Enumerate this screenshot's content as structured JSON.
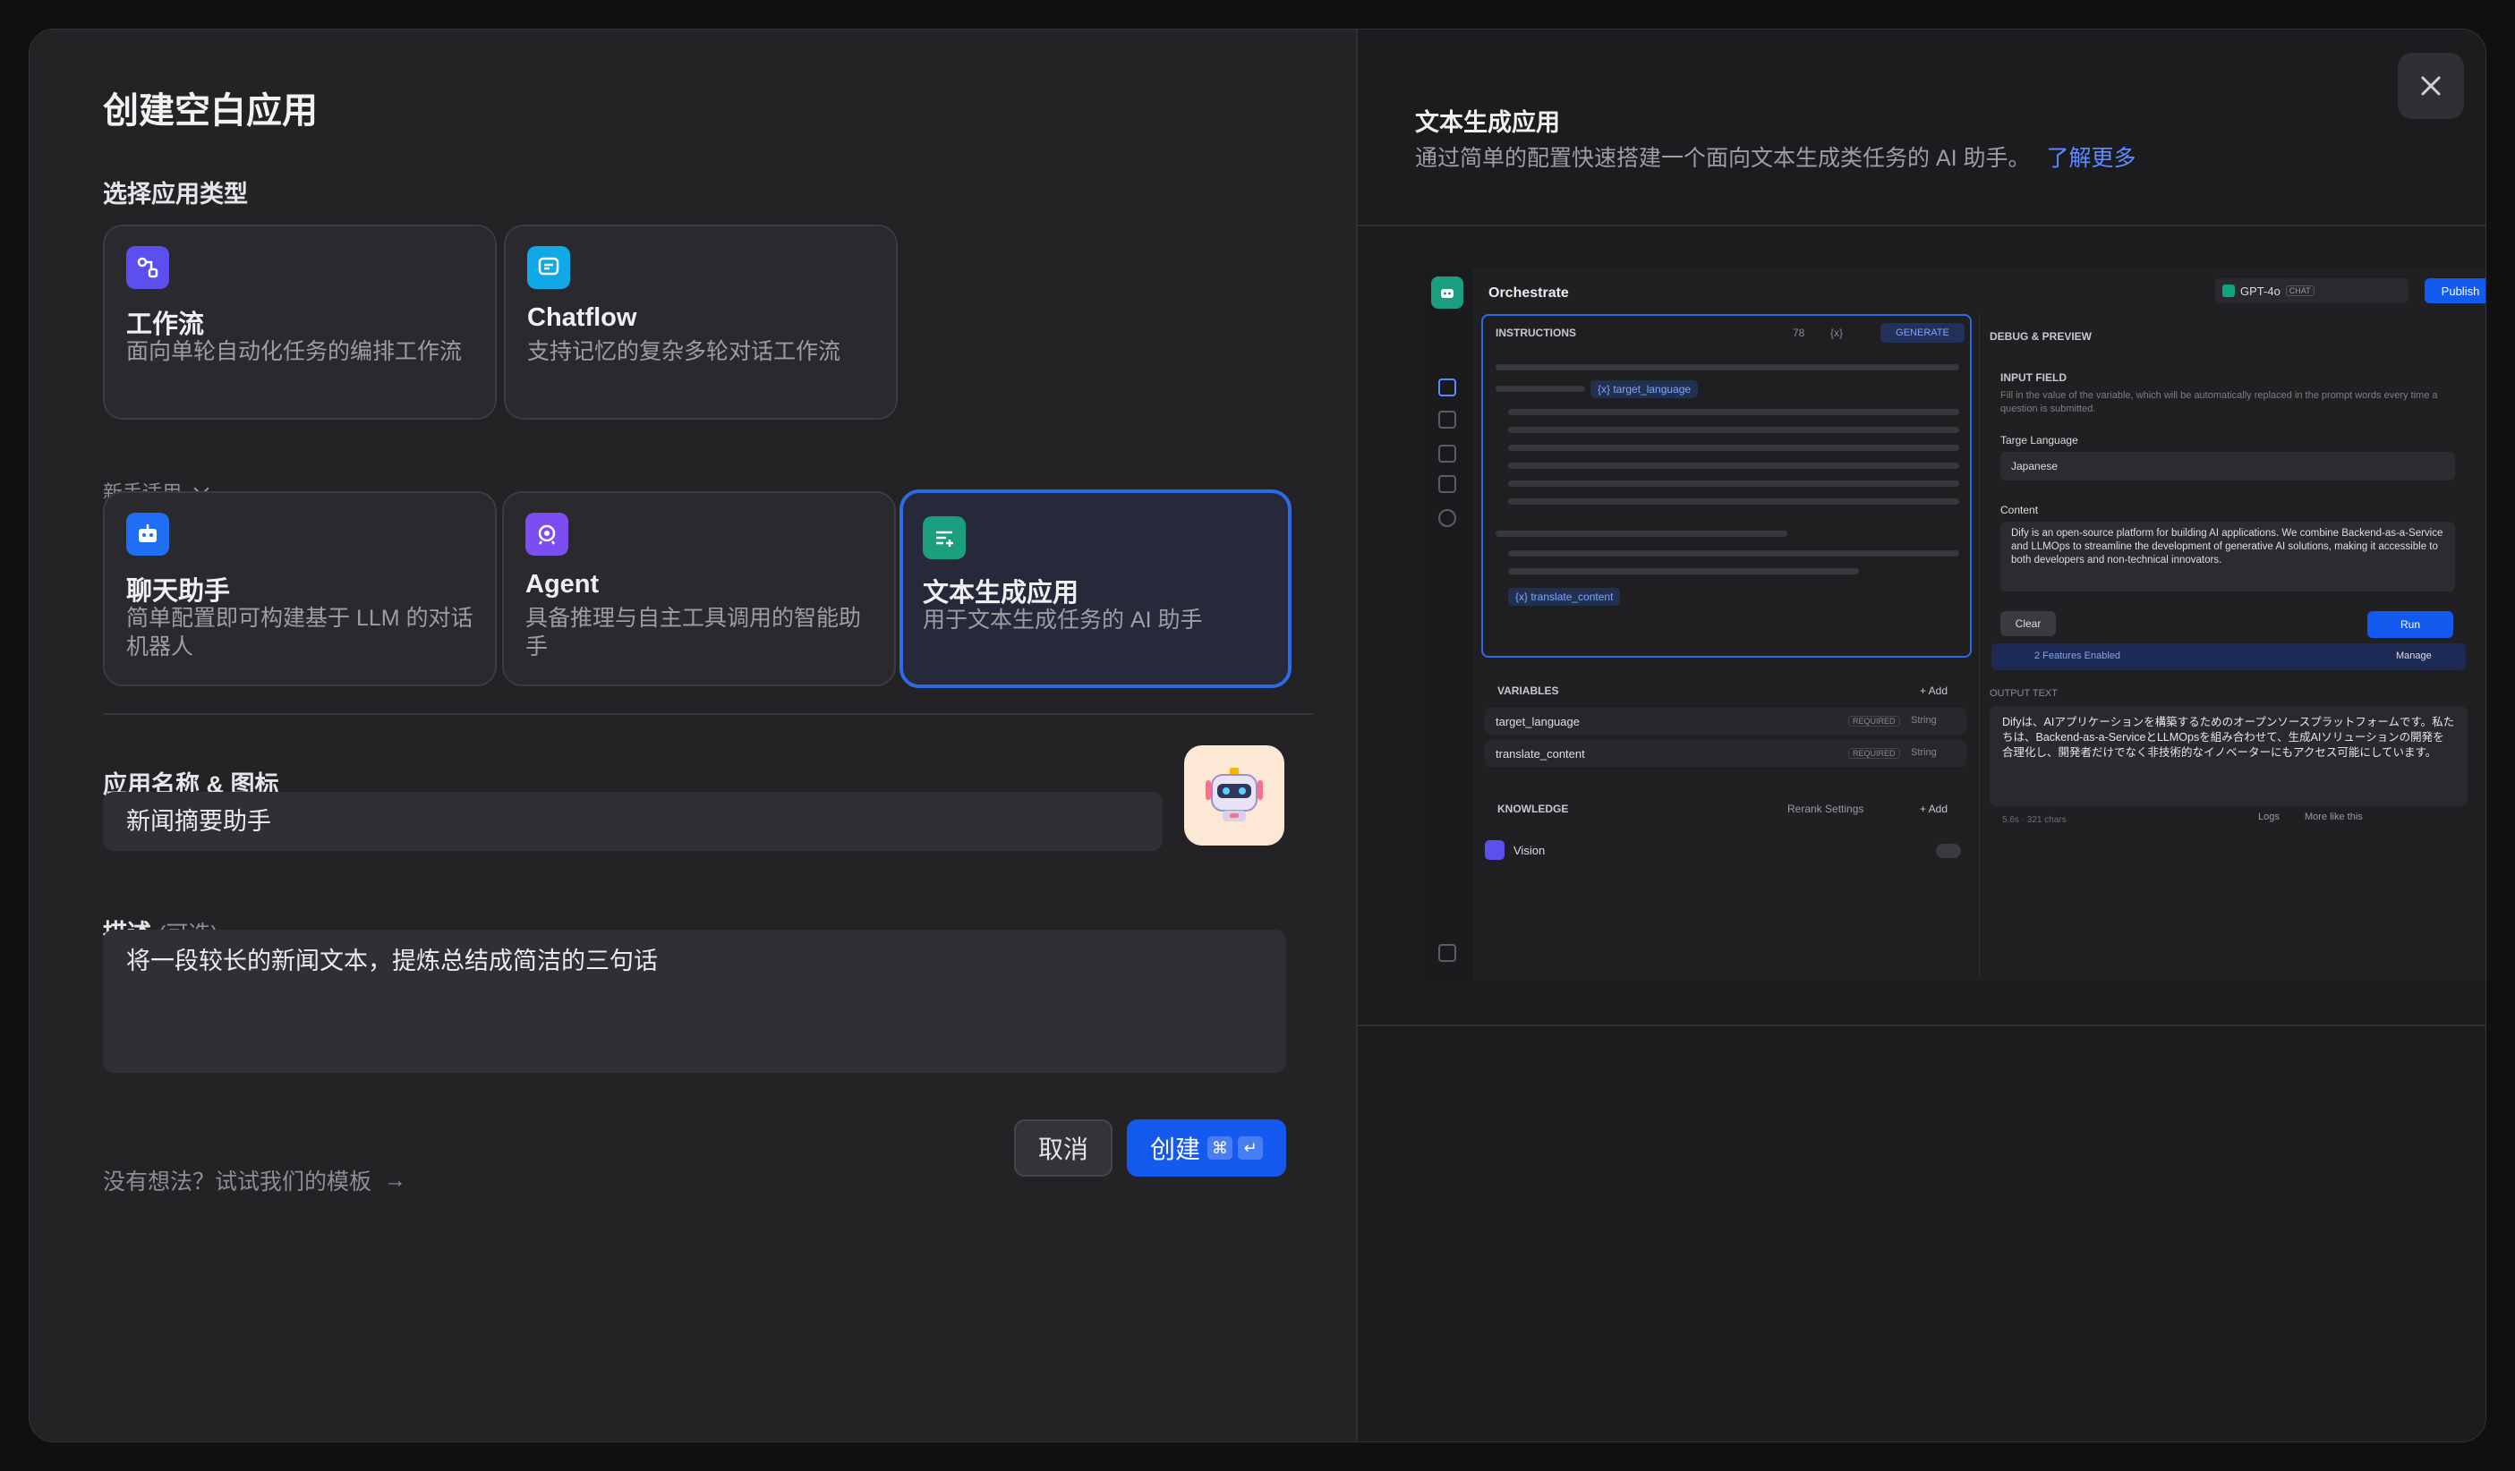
{
  "left": {
    "title": "创建空白应用",
    "section_type": "选择应用类型",
    "types": [
      {
        "name": "工作流",
        "desc": "面向单轮自动化任务的编排工作流",
        "icon": "workflow-icon",
        "color": "#5b4ff0"
      },
      {
        "name": "Chatflow",
        "desc": "支持记忆的复杂多轮对话工作流",
        "icon": "chatflow-icon",
        "color": "#11a8e8"
      }
    ],
    "beginner_label": "新手适用",
    "beginner_types": [
      {
        "name": "聊天助手",
        "desc": "简单配置即可构建基于 LLM 的对话机器人",
        "icon": "chatbot-icon",
        "color": "#1f6ef6"
      },
      {
        "name": "Agent",
        "desc": "具备推理与自主工具调用的智能助手",
        "icon": "agent-icon",
        "color": "#7c4df0"
      },
      {
        "name": "文本生成应用",
        "desc": "用于文本生成任务的 AI 助手",
        "icon": "text-generation-icon",
        "color": "#1a9e7e"
      }
    ],
    "name_section": "应用名称 & 图标",
    "name_value": "新闻摘要助手",
    "desc_section": "描述",
    "desc_optional": "(可选)",
    "desc_value": "将一段较长的新闻文本，提炼总结成简洁的三句话",
    "template_link": "没有想法？试试我们的模板",
    "cancel_label": "取消",
    "create_label": "创建",
    "create_kbd1": "⌘",
    "create_kbd2": "↵"
  },
  "right": {
    "title": "文本生成应用",
    "desc": "通过简单的配置快速搭建一个面向文本生成类任务的 AI 助手。",
    "learn_more": "了解更多"
  },
  "preview": {
    "header": "Orchestrate",
    "model": "GPT-4o",
    "model_tag": "CHAT",
    "publish": "Publish",
    "instructions": "INSTRUCTIONS",
    "token_count": "78",
    "var_symbol": "{x}",
    "generate": "GENERATE",
    "var1_chip": "{x} target_language",
    "var2_chip": "{x} translate_content",
    "variables": "VARIABLES",
    "add": "+ Add",
    "var_rows": [
      {
        "name": "target_language",
        "req": "REQUIRED",
        "type": "String"
      },
      {
        "name": "translate_content",
        "req": "REQUIRED",
        "type": "String"
      }
    ],
    "knowledge": "KNOWLEDGE",
    "rerank": "Rerank Settings",
    "vision": "Vision",
    "debug": "DEBUG & PREVIEW",
    "input_field": "INPUT FIELD",
    "input_hint": "Fill in the value of the variable, which will be automatically replaced in the prompt words every time a question is submitted.",
    "targe_label": "Targe Language",
    "targe_value": "Japanese",
    "content_label": "Content",
    "content_value": "Dify is an open-source platform for building AI applications. We combine Backend-as-a-Service and LLMOps to streamline the development of generative AI solutions, making it accessible to both developers and non-technical innovators.",
    "clear": "Clear",
    "run": "Run",
    "features": "2 Features Enabled",
    "manage": "Manage",
    "output_label": "OUTPUT TEXT",
    "output_value": "Difyは、AIアプリケーションを構築するためのオープンソースプラットフォームです。私たちは、Backend-as-a-ServiceとLLMOpsを組み合わせて、生成AIソリューションの開発を合理化し、開発者だけでなく非技術的なイノベーターにもアクセス可能にしています。",
    "meta": "5.6s · 321 chars",
    "logs": "Logs",
    "more_like": "More like this"
  }
}
